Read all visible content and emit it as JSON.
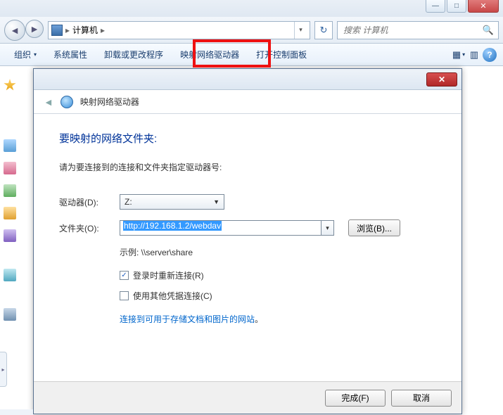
{
  "window": {
    "min_symbol": "—",
    "max_symbol": "□",
    "close_symbol": "✕"
  },
  "nav": {
    "back_symbol": "◄",
    "fwd_symbol": "►",
    "breadcrumb_root": "计算机",
    "breadcrumb_sep": "▸",
    "breadcrumb_dd": "▾",
    "refresh_symbol": "↻",
    "search_placeholder": "搜索 计算机",
    "search_icon": "🔍"
  },
  "toolbar": {
    "organize": "组织",
    "sys_props": "系统属性",
    "uninstall": "卸载或更改程序",
    "map_drive": "映射网络驱动器",
    "control_panel": "打开控制面板",
    "view_dd": "▾",
    "help": "?"
  },
  "dialog": {
    "close_symbol": "✕",
    "back_symbol": "◄",
    "title": "映射网络驱动器",
    "heading": "要映射的网络文件夹:",
    "instruction": "请为要连接到的连接和文件夹指定驱动器号:",
    "drive_label": "驱动器(D):",
    "drive_value": "Z:",
    "folder_label": "文件夹(O):",
    "folder_value": "http://192.168.1.2/webdav",
    "folder_dd": "▾",
    "browse_btn": "浏览(B)...",
    "example": "示例: \\\\server\\share",
    "reconnect_label": "登录时重新连接(R)",
    "reconnect_checked": "✓",
    "othercred_label": "使用其他凭据连接(C)",
    "link_text": "连接到可用于存储文档和图片的网站",
    "link_period": "。",
    "finish_btn": "完成(F)",
    "cancel_btn": "取消"
  }
}
